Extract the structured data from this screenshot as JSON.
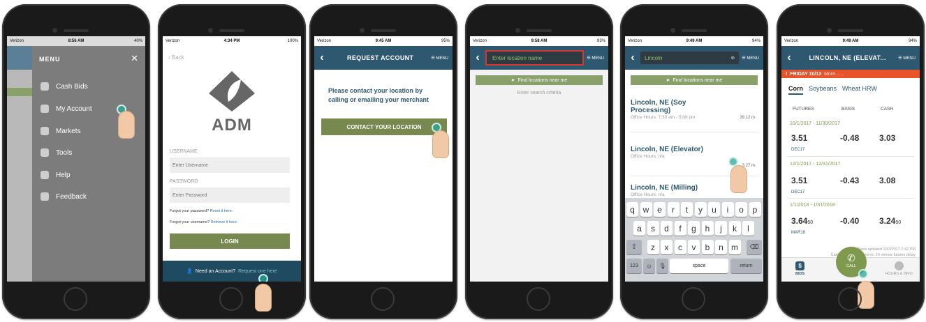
{
  "phone1": {
    "status": {
      "carrier": "Verizon",
      "time": "8:56 AM",
      "battery": "40%"
    },
    "menu_title": "MENU",
    "close": "✕",
    "items": [
      "Cash Bids",
      "My Account",
      "Markets",
      "Tools",
      "Help",
      "Feedback"
    ]
  },
  "phone2": {
    "status": {
      "carrier": "Verizon",
      "time": "4:34 PM",
      "battery": "100%"
    },
    "back": "Back",
    "logo": "ADM",
    "username_label": "USERNAME",
    "username_placeholder": "Enter Username",
    "password_label": "PASSWORD",
    "password_placeholder": "Enter Password",
    "forgot_password": "Forgot your password?",
    "forgot_password_link": "Reset it here.",
    "forgot_username": "Forgot your username?",
    "forgot_username_link": "Retrieve it here.",
    "login": "LOGIN",
    "need_account": "Need an Account?",
    "request_link": "Request one here"
  },
  "phone3": {
    "status": {
      "carrier": "Verizon",
      "time": "9:45 AM",
      "battery": "95%"
    },
    "title": "REQUEST ACCOUNT",
    "menu": "MENU",
    "message": "Please contact your location by calling or emailing your merchant",
    "button": "CONTACT YOUR LOCATION"
  },
  "phone4": {
    "status": {
      "carrier": "Verizon",
      "time": "9:58 AM",
      "battery": "93%"
    },
    "search_placeholder": "Enter location name",
    "menu": "MENU",
    "find": "Find locations near me",
    "hint": "Enter search criteria"
  },
  "phone5": {
    "status": {
      "carrier": "Verizon",
      "time": "9:49 AM",
      "battery": "94%"
    },
    "search_value": "Lincoln",
    "menu": "MENU",
    "find": "Find locations near me",
    "results": [
      {
        "name": "Lincoln, NE (Soy Processing)",
        "hours": "Office Hours: 7:30 am - 5:00 pm",
        "distance": "39.12 m"
      },
      {
        "name": "Lincoln, NE (Elevator)",
        "hours": "Office Hours: n/a",
        "distance": "3.27 m"
      },
      {
        "name": "Lincoln, NE (Milling)",
        "hours": "Office Hours: n/a",
        "distance": ""
      }
    ],
    "keyboard": {
      "row1": [
        "q",
        "w",
        "e",
        "r",
        "t",
        "y",
        "u",
        "i",
        "o",
        "p"
      ],
      "row2": [
        "a",
        "s",
        "d",
        "f",
        "g",
        "h",
        "j",
        "k",
        "l"
      ],
      "row3": [
        "z",
        "x",
        "c",
        "v",
        "b",
        "n",
        "m"
      ],
      "num": "123",
      "space": "space",
      "return": "return"
    }
  },
  "phone6": {
    "status": {
      "carrier": "Verizon",
      "time": "9:49 AM",
      "battery": "94%"
    },
    "title": "LINCOLN, NE (ELEVAT...",
    "menu": "MENU",
    "alert": "FRIDAY 10/13",
    "alert_more": "More......",
    "tabs": [
      "Corn",
      "Soybeans",
      "Wheat HRW"
    ],
    "cols": [
      "FUTURES",
      "BASIS",
      "CASH"
    ],
    "rows": [
      {
        "range": "10/1/2017 - 11/30/2017",
        "futures": "3.51",
        "contract": "DEC17",
        "basis": "-0.48",
        "cash": "3.03"
      },
      {
        "range": "12/1/2017 - 12/31/2017",
        "futures": "3.51",
        "contract": "DEC17",
        "basis": "-0.43",
        "cash": "3.08"
      },
      {
        "range": "1/1/2018 - 1/31/2018",
        "futures": "3.64",
        "futures_frac": "50",
        "contract": "MAR18",
        "basis": "-0.40",
        "cash": "3.24",
        "cash_frac": "50"
      }
    ],
    "updated": "Basis updated 10/3/2017 1:42 PM",
    "disclaimer": "Cash prices are based on 10 minute futures delay",
    "bottom": [
      "BIDS",
      "CALL",
      "HOURS & INFO"
    ]
  },
  "colors": {
    "nav": "#2e5870",
    "green": "#77894f",
    "alert": "#e8532a"
  }
}
